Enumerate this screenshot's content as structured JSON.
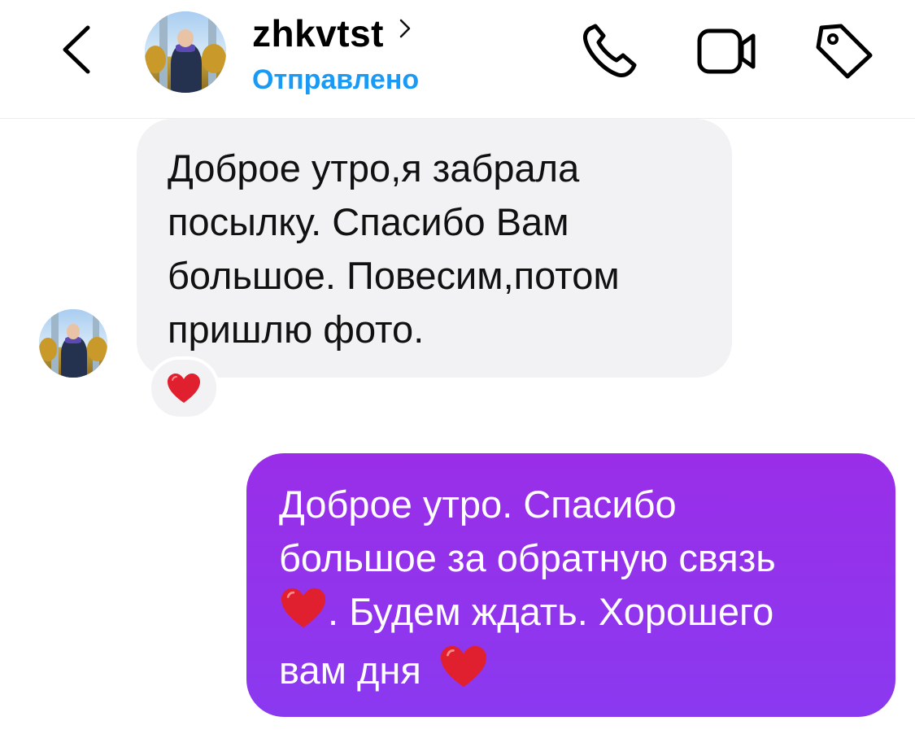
{
  "header": {
    "username": "zhkvtst",
    "status": "Отправлено"
  },
  "icons": {
    "back": "chevron-left-icon",
    "chevron": "chevron-right-icon",
    "phone": "phone-icon",
    "video": "video-camera-icon",
    "tag": "tag-icon",
    "heart": "red-heart-icon"
  },
  "colors": {
    "status_blue": "#1a9af5",
    "incoming_bubble": "#f2f2f4",
    "outgoing_bubble_top": "#9a2ee8",
    "outgoing_bubble_bottom": "#8a39f0",
    "heart_red": "#e0202f"
  },
  "messages": {
    "incoming": {
      "text": "Доброе утро,я забрала\nпосылку. Спасибо Вам\nбольшое. Повесим,потом\nпришлю фото.",
      "reaction": "❤️"
    },
    "outgoing": {
      "line1": "Доброе утро. Спасибо",
      "line2": "большое за обратную связь",
      "line3_after_heart": ". Будем ждать. Хорошего",
      "line4": "вам дня"
    }
  }
}
